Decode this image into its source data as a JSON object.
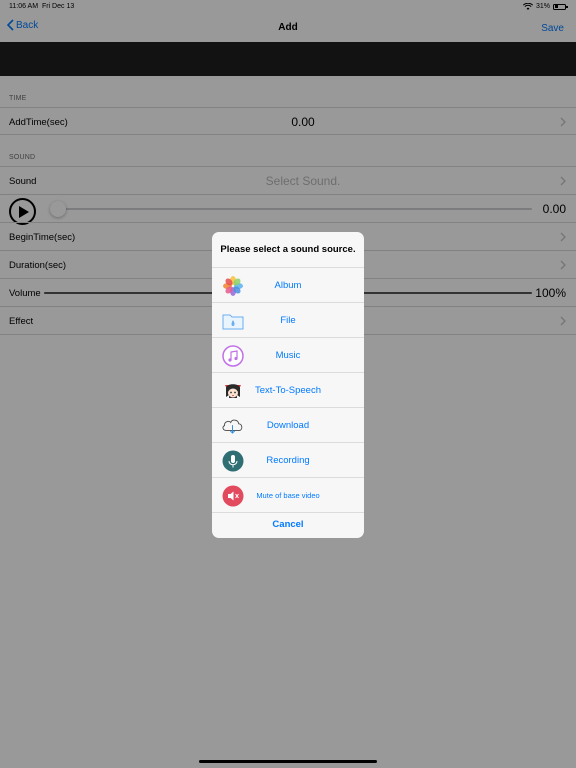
{
  "status_bar": {
    "time": "11:06 AM",
    "date": "Fri Dec 13",
    "battery": "31%",
    "battery_level": 0.31
  },
  "nav": {
    "back_label": "Back",
    "title": "Add",
    "save_label": "Save"
  },
  "sections": {
    "time_header": "TIME",
    "sound_header": "SOUND"
  },
  "rows": {
    "add_time": {
      "label": "AddTime(sec)",
      "value": "0.00"
    },
    "sound": {
      "label": "Sound",
      "placeholder": "Select Sound."
    },
    "player": {
      "value": "0.00",
      "progress": 0
    },
    "begin_time": {
      "label": "BeginTime(sec)"
    },
    "duration": {
      "label": "Duration(sec)"
    },
    "volume": {
      "label": "Volume",
      "value": "100%",
      "level": 1.0
    },
    "effect": {
      "label": "Effect"
    }
  },
  "sheet": {
    "title": "Please select a sound source.",
    "items": [
      {
        "label": "Album",
        "icon": "photos-icon"
      },
      {
        "label": "File",
        "icon": "folder-icon"
      },
      {
        "label": "Music",
        "icon": "music-icon"
      },
      {
        "label": "Text-To-Speech",
        "icon": "character-icon"
      },
      {
        "label": "Download",
        "icon": "cloud-download-icon"
      },
      {
        "label": "Recording",
        "icon": "microphone-icon"
      },
      {
        "label": "Mute of base video",
        "icon": "mute-speaker-icon"
      }
    ],
    "cancel_label": "Cancel"
  },
  "colors": {
    "accent": "#007aff",
    "dim_overlay": "rgba(0,0,0,0.4)",
    "video_strip": "#1f1f1f"
  }
}
